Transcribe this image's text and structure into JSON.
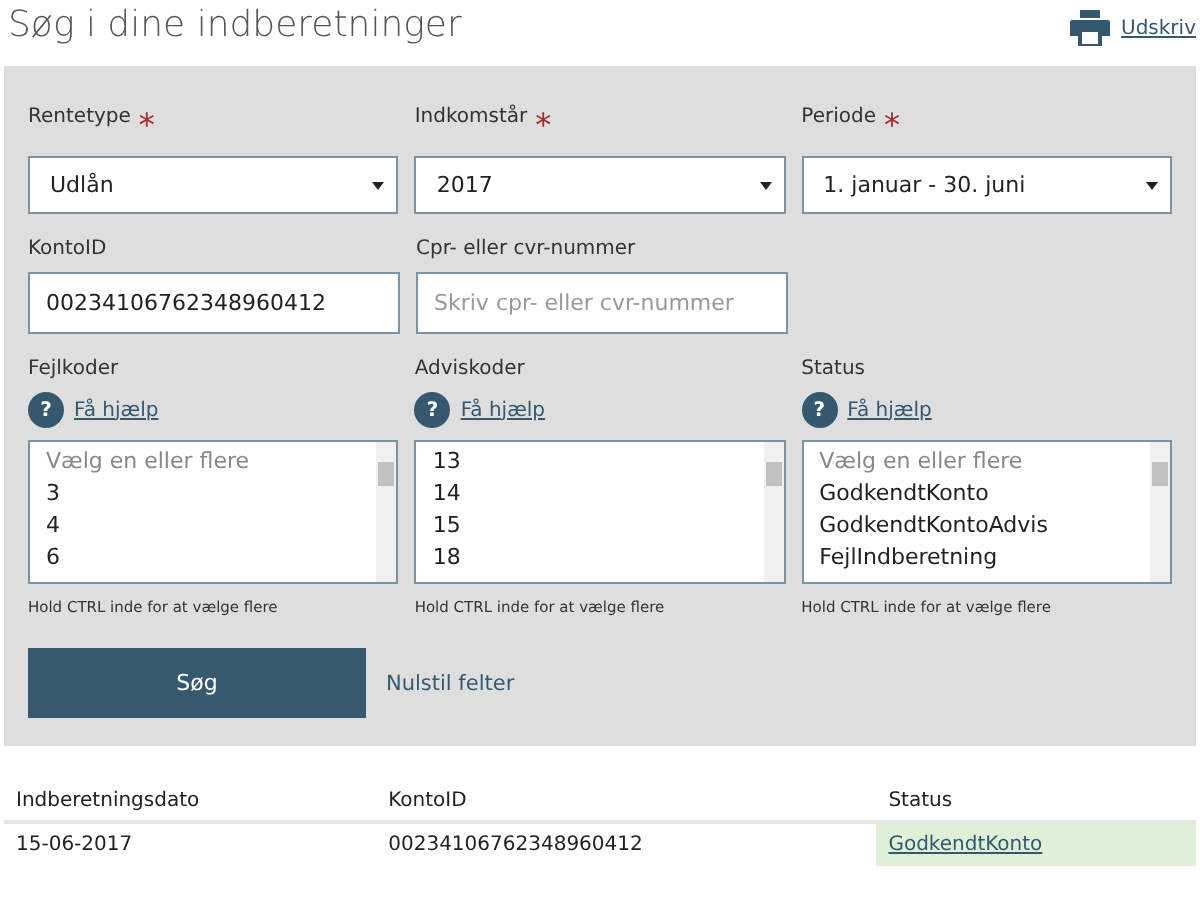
{
  "title": "Søg i dine indberetninger",
  "print_link": "Udskriv",
  "selects": [
    {
      "label": "Rentetype",
      "required_mark": "*",
      "value": "Udlån"
    },
    {
      "label": "Indkomstår",
      "required_mark": "*",
      "value": "2017"
    },
    {
      "label": "Periode",
      "required_mark": "*",
      "value": "1. januar - 30. juni"
    }
  ],
  "inputs": [
    {
      "label": "KontoID",
      "value": "00234106762348960412"
    },
    {
      "label": "Cpr- eller cvr-nummer",
      "placeholder": "Skriv cpr- eller cvr-nummer"
    }
  ],
  "listboxes": [
    {
      "label": "Fejlkoder",
      "help_icon": "?",
      "help": "Få hjælp",
      "placeholder": "Vælg en eller flere",
      "options": [
        "3",
        "4",
        "6"
      ],
      "hint": "Hold CTRL inde for at vælge flere"
    },
    {
      "label": "Adviskoder",
      "help_icon": "?",
      "help": "Få hjælp",
      "options": [
        "13",
        "14",
        "15",
        "18"
      ],
      "hint": "Hold CTRL inde for at vælge flere"
    },
    {
      "label": "Status",
      "help_icon": "?",
      "help": "Få hjælp",
      "placeholder": "Vælg en eller flere",
      "options": [
        "GodkendtKonto",
        "GodkendtKontoAdvis",
        "FejlIndberetning"
      ],
      "hint": "Hold CTRL inde for at vælge flere"
    }
  ],
  "search_button": "Søg",
  "reset_link": "Nulstil felter",
  "table": {
    "columns": [
      "Indberetningsdato",
      "KontoID",
      "Status"
    ],
    "rows": [
      {
        "date": "15-06-2017",
        "konto": "00234106762348960412",
        "status": "GodkendtKonto",
        "color": "#dff0d8"
      }
    ]
  }
}
